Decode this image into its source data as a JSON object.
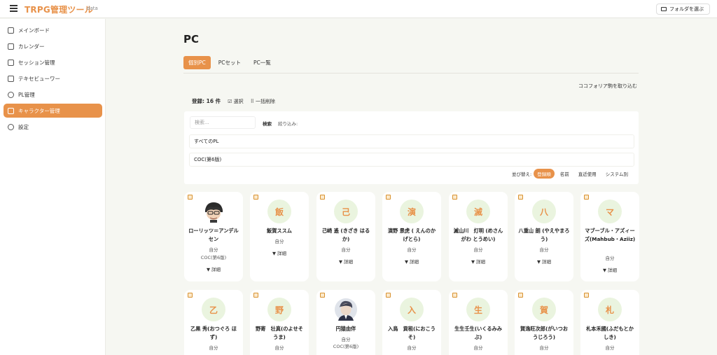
{
  "app": {
    "title": "TRPG管理ツール",
    "subtitle": "data",
    "folder_button": "フォルダを選ぶ"
  },
  "sidebar": {
    "items": [
      {
        "label": "メインボード",
        "icon": "home-icon"
      },
      {
        "label": "カレンダー",
        "icon": "calendar-icon"
      },
      {
        "label": "セッション管理",
        "icon": "session-icon"
      },
      {
        "label": "テキセビューワー",
        "icon": "document-icon"
      },
      {
        "label": "PL管理",
        "icon": "users-icon"
      },
      {
        "label": "キャラクター管理",
        "icon": "character-icon",
        "active": true
      },
      {
        "label": "設定",
        "icon": "gear-icon"
      }
    ]
  },
  "page": {
    "title": "PC"
  },
  "tabs": [
    {
      "label": "個別PC",
      "active": true
    },
    {
      "label": "PCセット"
    },
    {
      "label": "PC一覧"
    }
  ],
  "toolbar": {
    "import_label": "ココフォリア駒を取り込む",
    "count_label": "登録: 16 件",
    "select_label": "☑ 選択",
    "bulk_delete_label": "⠿ 一括削除"
  },
  "filter": {
    "search_placeholder": "検索...",
    "search_button": "検索",
    "filter_label": "絞り込み:",
    "pl_select": "すべてのPL",
    "system_select": "COC(第6版)",
    "sort_label": "並び替え:",
    "sort_options": [
      {
        "label": "登録順",
        "active": true
      },
      {
        "label": "名前"
      },
      {
        "label": "直近使用"
      },
      {
        "label": "システム別"
      }
    ]
  },
  "detail_label": "▼ 詳細",
  "cards": [
    {
      "initial": "",
      "avatar": "image-male-chibi",
      "name": "ローリッツ＝アンデルセン",
      "owner": "自分",
      "system": "COC(第6版)"
    },
    {
      "initial": "飯",
      "name": "飯賀ススム",
      "owner": "自分",
      "system": ""
    },
    {
      "initial": "己",
      "name": "己崎 遙 (きざき はるか)",
      "owner": "自分",
      "system": ""
    },
    {
      "initial": "演",
      "name": "演野 景虎 ( えんのかげとら)",
      "owner": "自分",
      "system": ""
    },
    {
      "initial": "滅",
      "name": "滅山川　灯明 (めさんがわ とうめい)",
      "owner": "自分",
      "system": ""
    },
    {
      "initial": "八",
      "name": "八重山 朗 (やえやまろう)",
      "owner": "自分",
      "system": ""
    },
    {
      "initial": "マ",
      "name": "マブーブル・アズィーズ(Mahbub・Aziiz)",
      "owner": "自分",
      "system": ""
    },
    {
      "initial": "乙",
      "name": "乙黒 秀(おつぐろ ほず)",
      "owner": "自分",
      "system": ""
    },
    {
      "initial": "野",
      "name": "野寄　壮真(のよせそうま)",
      "owner": "自分",
      "system": ""
    },
    {
      "initial": "",
      "avatar": "image-suit-man",
      "name": "円猿由伴",
      "owner": "自分",
      "system": "COC(第6版)"
    },
    {
      "initial": "入",
      "name": "入鳥　貢租(におこうそ)",
      "owner": "自分",
      "system": ""
    },
    {
      "initial": "生",
      "name": "生生壬生(いくるみみぶ)",
      "owner": "自分",
      "system": ""
    },
    {
      "initial": "賀",
      "name": "賀逸旺次郎(がいつおうじろう)",
      "owner": "自分",
      "system": ""
    },
    {
      "initial": "札",
      "name": "札本禾國(ふだもとかしき)",
      "owner": "自分",
      "system": ""
    }
  ]
}
